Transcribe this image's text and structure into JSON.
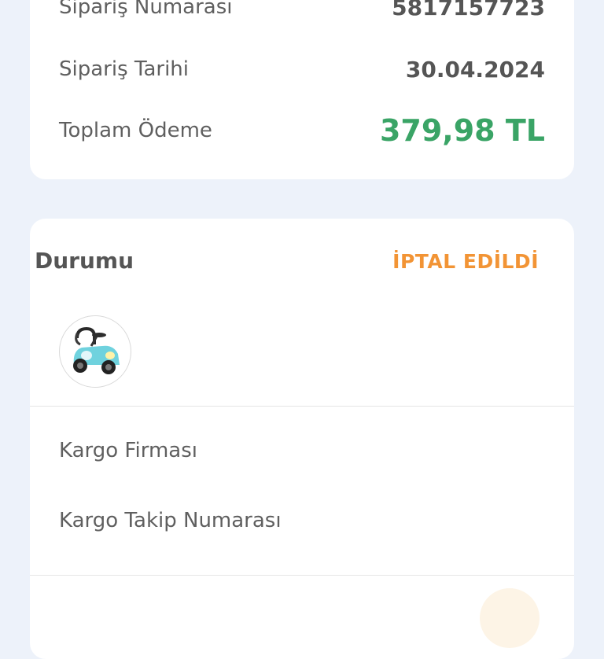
{
  "summary": {
    "order_number_label": "Sipariş Numarası",
    "order_number_value": "5817157723",
    "order_date_label": "Sipariş Tarihi",
    "order_date_value": "30.04.2024",
    "total_label": "Toplam Ödeme",
    "total_value": "379,98 TL"
  },
  "status": {
    "title": "Durumu",
    "value": "İPTAL EDİLDİ",
    "product_image_icon": "ride-on-toy-car-icon"
  },
  "shipping": {
    "company_label": "Kargo Firması",
    "tracking_label": "Kargo Takip Numarası"
  },
  "colors": {
    "background": "#edf2fa",
    "total_green": "#3aa466",
    "status_orange": "#f29435"
  }
}
